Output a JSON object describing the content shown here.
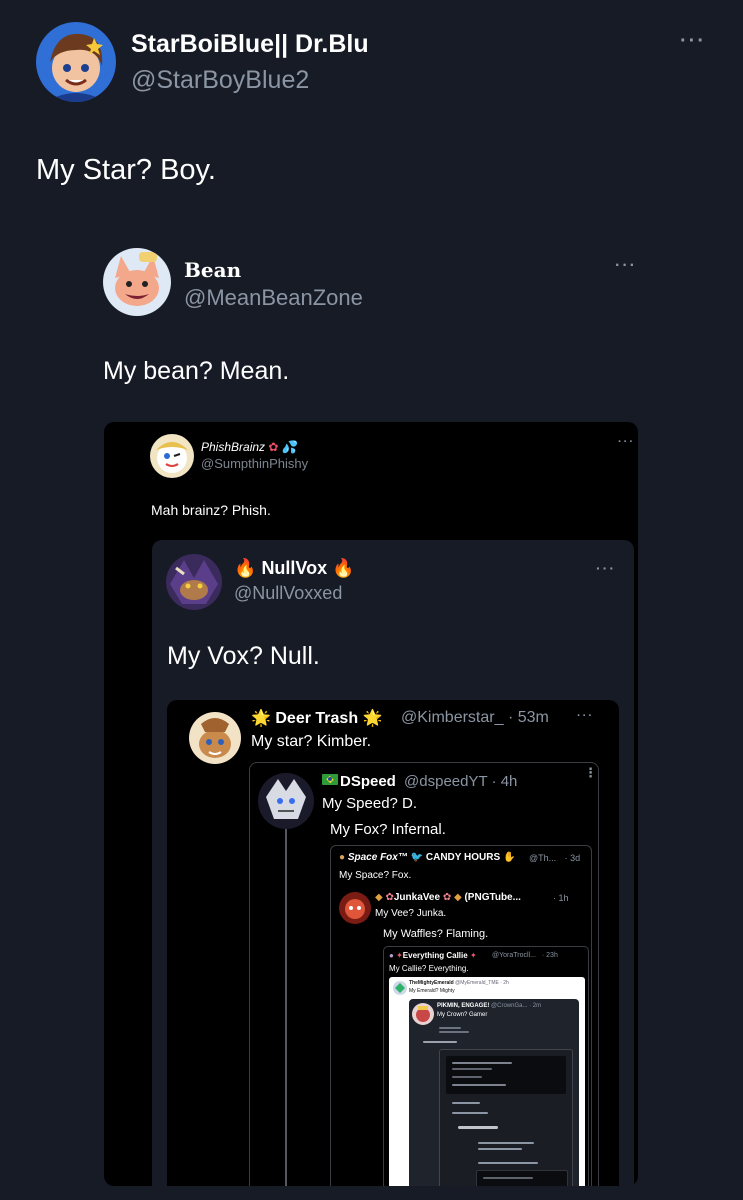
{
  "main": {
    "author_name": "StarBoiBlue|| Dr.Blu",
    "author_handle": "@StarBoyBlue2",
    "text": "My Star? Boy.",
    "more_icon": "more-dots-icon"
  },
  "quote1": {
    "author_name": "Bean",
    "author_handle": "@MeanBeanZone",
    "text": "My bean?  Mean."
  },
  "quote2": {
    "author_name": "PhishBrainz",
    "author_handle": "@SumpthinPhishy",
    "text": "Mah brainz? Phish."
  },
  "quote3": {
    "author_name": "NullVox",
    "author_handle": "@NullVoxxed",
    "text": "My Vox? Null."
  },
  "quote4": {
    "author_name": "Deer Trash",
    "author_handle": "@Kimberstar_",
    "time": "· 53m",
    "text": "My star? Kimber."
  },
  "quote5": {
    "author_name": "DSpeed",
    "author_handle": "@dspeedYT · 4h",
    "text": "My Speed? D.",
    "reply_text": "My Fox? Infernal."
  },
  "quote6": {
    "author_name": "Space Fox™",
    "author_extra": "CANDY HOURS",
    "author_handle": "@Th...",
    "time": "· 3d",
    "text": "My Space? Fox."
  },
  "quote7": {
    "author_name": "JunkaVee",
    "author_extra": "(PNGTube...",
    "time": "· 1h",
    "text": "My Vee? Junka.",
    "reply_text": "My Waffles? Flaming."
  },
  "quote8": {
    "author_name": "Everything Callie",
    "author_handle": "@YoraTrocll...",
    "time": "· 23h",
    "text": "My Callie? Everything."
  },
  "quote9": {
    "author_name": "TheMightyEmerald",
    "author_handle": "@MyEmerald_TME · 2h",
    "text": "My Emerald? Mighty"
  },
  "quote10": {
    "author_name": "PIKMIN, ENGAGE!",
    "author_handle": "@CrownGa...",
    "time": "· 2m",
    "text": "My Crown? Gamer"
  }
}
